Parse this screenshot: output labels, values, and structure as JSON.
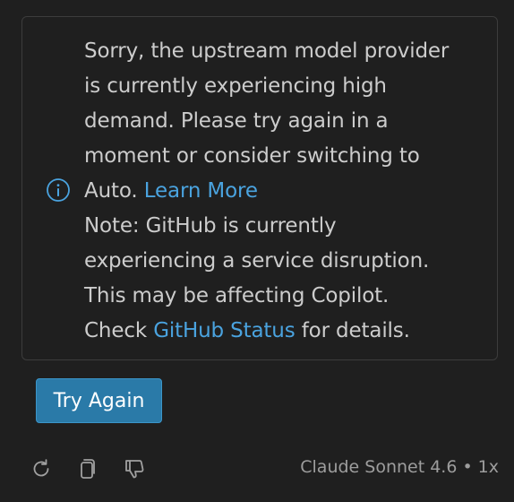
{
  "message": {
    "line1": "Sorry, the upstream model provider",
    "line2": "is currently experiencing high",
    "line3": "demand. Please try again in a",
    "line4": "moment or consider switching to",
    "line5_prefix": "Auto.",
    "learn_more_link": "Learn More",
    "line6": "Note: GitHub is currently",
    "line7": "experiencing a service disruption.",
    "line8": "This may be affecting Copilot.",
    "line9_prefix": "Check",
    "status_link": "GitHub Status",
    "line9_suffix": "for details."
  },
  "try_again_label": "Try Again",
  "toolbar": {
    "icons": [
      "retry-icon",
      "copy-icon",
      "thumbs-down-icon"
    ]
  },
  "model": {
    "name": "Claude Sonnet 4.6",
    "separator": "•",
    "multiplier": "1x"
  },
  "colors": {
    "background": "#1f1f1f",
    "text": "#cccccc",
    "link": "#4aa3df",
    "button": "#2a7aa8",
    "border": "#3c3c3c",
    "muted": "#9d9d9d"
  }
}
